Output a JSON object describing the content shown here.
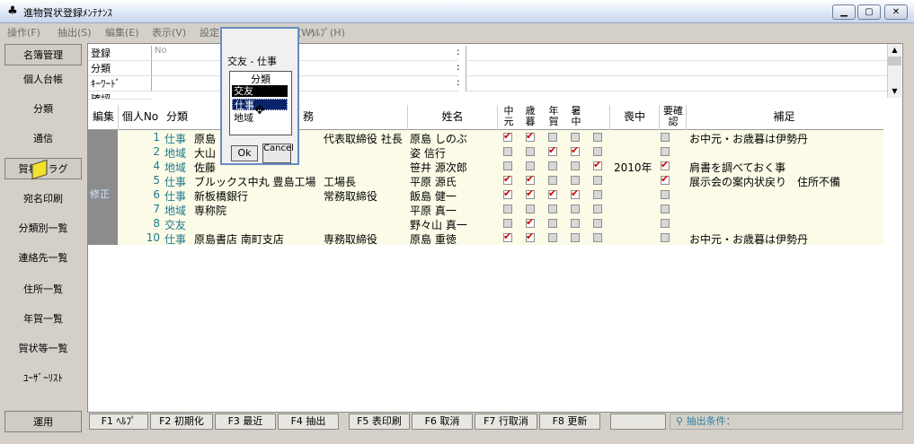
{
  "window": {
    "title": "進物賀状登録ﾒﾝﾃﾅﾝｽ"
  },
  "menu": [
    "操作(F)",
    "抽出(S)",
    "編集(E)",
    "表示(V)",
    "設定(G)",
    "ウィンドウ(W)",
    "ﾍﾙﾌﾟ(H)"
  ],
  "sidebar": {
    "items": [
      "名簿管理",
      "個人台帳",
      "分類",
      "通信",
      "賀状フラグ",
      "宛名印刷",
      "分類別一覧",
      "連絡先一覧",
      "住所一覧",
      "年賀一覧",
      "賀状等一覧",
      "ﾕｰｻﾞｰﾘｽﾄ"
    ],
    "bottom": "運用"
  },
  "filters": {
    "labels": [
      "登録",
      "分類",
      "ｷｰﾜｰﾄﾞ",
      "確認"
    ],
    "register_value": "No"
  },
  "table": {
    "headers": {
      "edit": "編集",
      "no": "個人No",
      "cat": "分類",
      "work": "務",
      "name": "姓名",
      "chugen": "中元",
      "seibo": "歳暮",
      "nenga": "年賀",
      "shochu": "暑中",
      "mochu": "喪中",
      "confirm": "要確認",
      "note": "補足"
    },
    "rows": [
      {
        "edit": "",
        "no": "1",
        "cat": "仕事",
        "company": "原島",
        "title": "代表取締役 社長",
        "name": "原島 しのぶ",
        "c1": true,
        "c2": true,
        "c3": false,
        "c4": false,
        "c5": false,
        "mochu": "",
        "confirm": false,
        "note": "お中元・お歳暮は伊勢丹"
      },
      {
        "edit": "",
        "no": "2",
        "cat": "地域",
        "company": "大山",
        "title": "",
        "name": "姿 信行",
        "c1": false,
        "c2": false,
        "c3": true,
        "c4": true,
        "c5": false,
        "mochu": "",
        "confirm": false,
        "note": ""
      },
      {
        "edit": "",
        "no": "4",
        "cat": "地域",
        "company": "佐藤",
        "title": "",
        "name": "笹井 源次郎",
        "c1": false,
        "c2": false,
        "c3": false,
        "c4": false,
        "c5": true,
        "mochu": "2010年",
        "confirm": true,
        "note": "肩書を調べておく事"
      },
      {
        "edit": "",
        "no": "5",
        "cat": "仕事",
        "company": "ブルックス中丸 豊島工場",
        "title": "工場長",
        "name": "平原 源氏",
        "c1": true,
        "c2": true,
        "c3": false,
        "c4": false,
        "c5": false,
        "mochu": "",
        "confirm": true,
        "note": "展示会の案内状戻り　住所不備"
      },
      {
        "edit": "修正",
        "no": "6",
        "cat": "仕事",
        "company": "新板橋銀行",
        "title": "常務取締役",
        "name": "飯島 健一",
        "c1": true,
        "c2": true,
        "c3": true,
        "c4": true,
        "c5": false,
        "mochu": "",
        "confirm": false,
        "note": ""
      },
      {
        "edit": "",
        "no": "7",
        "cat": "地域",
        "company": "専称院",
        "title": "",
        "name": "平原 真一",
        "c1": false,
        "c2": false,
        "c3": false,
        "c4": false,
        "c5": false,
        "mochu": "",
        "confirm": false,
        "note": ""
      },
      {
        "edit": "",
        "no": "8",
        "cat": "交友",
        "company": "",
        "title": "",
        "name": "野々山 真一",
        "c1": false,
        "c2": true,
        "c3": false,
        "c4": false,
        "c5": false,
        "mochu": "",
        "confirm": false,
        "note": ""
      },
      {
        "edit": "",
        "no": "10",
        "cat": "仕事",
        "company": "原島書店 南町支店",
        "title": "専務取締役",
        "name": "原島 重徳",
        "c1": true,
        "c2": true,
        "c3": false,
        "c4": false,
        "c5": false,
        "mochu": "",
        "confirm": false,
        "note": "お中元・お歳暮は伊勢丹"
      }
    ]
  },
  "popup": {
    "title": "交友 - 仕事",
    "items": [
      "分類",
      "交友",
      "仕事",
      "地域"
    ],
    "ok": "Ok",
    "cancel": "Cancel"
  },
  "fkeys": [
    "F1 ﾍﾙﾌﾟ",
    "F2 初期化",
    "F3 最近",
    "F4 抽出",
    "F5 表印刷",
    "F6 取消",
    "F7 行取消",
    "F8 更新",
    ""
  ],
  "status": {
    "condition": "抽出条件："
  },
  "colors": {
    "accent": "#1f7a8c",
    "check": "#d40000",
    "row_bg": "#fbfbe8"
  }
}
